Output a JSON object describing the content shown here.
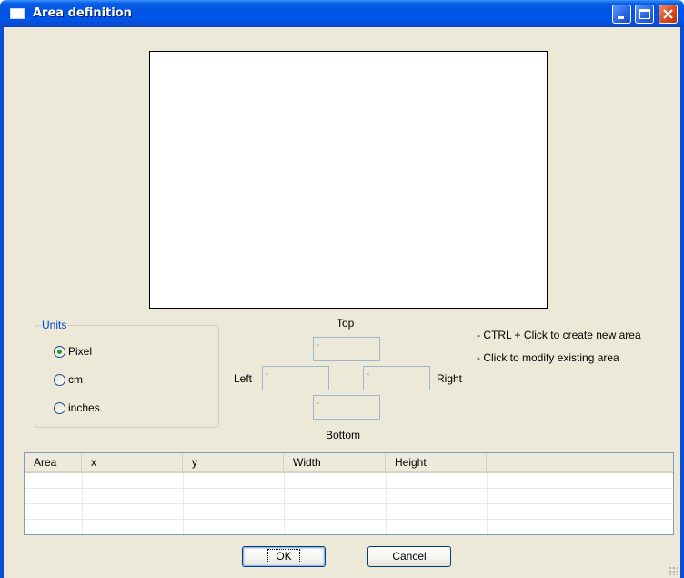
{
  "window": {
    "title": "Area definition"
  },
  "units": {
    "group_label": "Units",
    "options": [
      "Pixel",
      "cm",
      "inches"
    ],
    "selected": "Pixel"
  },
  "position": {
    "top_label": "Top",
    "left_label": "Left",
    "right_label": "Right",
    "bottom_label": "Bottom",
    "top_value": "-",
    "left_value": "-",
    "right_value": "-",
    "bottom_value": "-"
  },
  "hints": {
    "line1": "- CTRL + Click to create new area",
    "line2": "- Click to modify existing area"
  },
  "table": {
    "columns": [
      "Area",
      "x",
      "y",
      "Width",
      "Height"
    ],
    "rows": []
  },
  "buttons": {
    "ok": "OK",
    "cancel": "Cancel"
  },
  "colors": {
    "titlebar": "#0054e3",
    "client": "#ece9d8",
    "group_label": "#0046d5"
  }
}
